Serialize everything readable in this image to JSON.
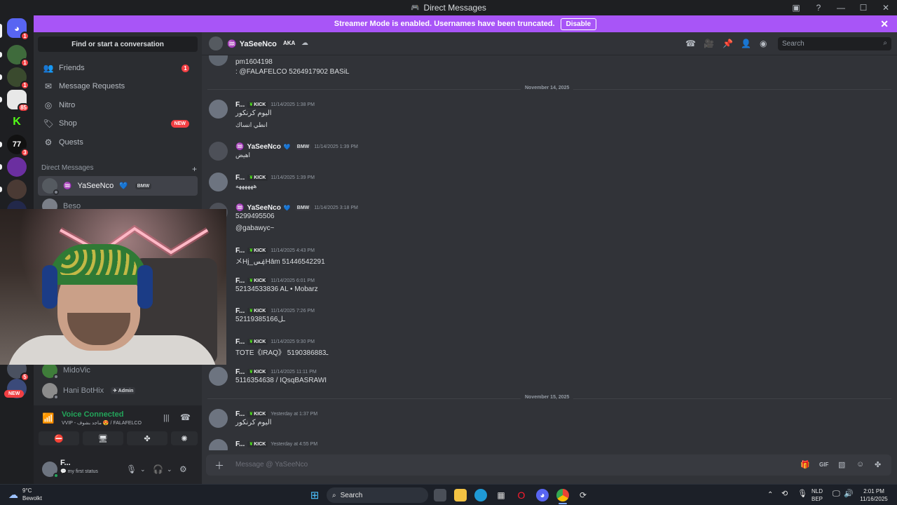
{
  "window": {
    "title": "Direct Messages"
  },
  "banner": {
    "text": "Streamer Mode is enabled. Usernames have been truncated.",
    "button": "Disable"
  },
  "rail": {
    "badges": [
      "1",
      "1",
      "85",
      "3",
      "5"
    ],
    "new_label": "NEW"
  },
  "sidebar": {
    "find_label": "Find or start a conversation",
    "nav": [
      {
        "label": "Friends",
        "icon": "friends-icon",
        "badge": "1"
      },
      {
        "label": "Message Requests",
        "icon": "mail-icon"
      },
      {
        "label": "Nitro",
        "icon": "nitro-icon"
      },
      {
        "label": "Shop",
        "icon": "shop-icon",
        "badge": "NEW"
      },
      {
        "label": "Quests",
        "icon": "quests-icon"
      }
    ],
    "dm_header": "Direct Messages",
    "dm_add": "+",
    "dms": [
      {
        "name": "YaSeeNco",
        "clan": "BMW"
      },
      {
        "name": "Beso"
      },
      {
        "name": "MidoVic"
      },
      {
        "name": "Hani BotHix",
        "clan": "Admin"
      }
    ]
  },
  "voice": {
    "title": "Voice Connected",
    "subtitle": "VVIP - ماجد بشوف 😍 / FALAFELCO",
    "user_name": "F...",
    "user_status": "my first status"
  },
  "chat_header": {
    "name": "YaSeeNco",
    "aka": "AKA",
    "search_placeholder": "Search"
  },
  "messages": {
    "top_lines": [
      "pm1604198",
      ": @FALAFELCO 5264917902 BASiL"
    ],
    "divider1": "November 14, 2025",
    "divider2": "November 15, 2025",
    "items": [
      {
        "author": "F...",
        "tag": "KICK",
        "time": "11/14/2025 1:38 PM",
        "lines": [
          "اليوم كرنكور",
          "انطي انساك"
        ]
      },
      {
        "author": "YaSeeNco",
        "tag": "BMW",
        "time": "11/14/2025 1:39 PM",
        "lines": [
          "اهيض"
        ]
      },
      {
        "author": "F...",
        "tag": "KICK",
        "time": "11/14/2025 1:39 PM",
        "lines": [
          "ههههههه"
        ]
      },
      {
        "author": "YaSeeNco",
        "tag": "BMW",
        "time": "11/14/2025 3:18 PM",
        "lines": [
          "5299495506",
          "@gabawyc~"
        ]
      },
      {
        "author": "F...",
        "tag": "KICK",
        "time": "11/14/2025 4:43 PM",
        "lines": [
          "メHj_ۼسHām 51446542291"
        ]
      },
      {
        "author": "F...",
        "tag": "KICK",
        "time": "11/14/2025 6:01 PM",
        "lines": [
          "52134533836 AL • Mobarz"
        ]
      },
      {
        "author": "F...",
        "tag": "KICK",
        "time": "11/14/2025 7:26 PM",
        "lines": [
          "52119385166ـل"
        ]
      },
      {
        "author": "F...",
        "tag": "KICK",
        "time": "11/14/2025 9:30 PM",
        "lines": [
          "TOTE《IRAQ》 5190386883ـ"
        ]
      },
      {
        "author": "F...",
        "tag": "KICK",
        "time": "11/14/2025 11:11 PM",
        "lines": [
          "5116354638 / IQsqBASRAWI"
        ]
      },
      {
        "author": "F...",
        "tag": "KICK",
        "time": "Yesterday at 1:37 PM",
        "lines": [
          "اليوم كرنكور"
        ]
      },
      {
        "author": "F...",
        "tag": "KICK",
        "time": "Yesterday at 4:55 PM",
        "lines": [
          ""
        ]
      }
    ]
  },
  "composer": {
    "placeholder": "Message @ YaSeeNco"
  },
  "taskbar": {
    "weather_temp": "9°C",
    "weather_desc": "Bewolkt",
    "search_label": "Search",
    "lang": "NLD",
    "layout": "BEP",
    "time": "2:01 PM",
    "date": "11/16/2025"
  },
  "colors": {
    "banner": "#a855f7",
    "voice_green": "#23a55a",
    "badge_red": "#f23f43",
    "kick_green": "#53fc18"
  }
}
